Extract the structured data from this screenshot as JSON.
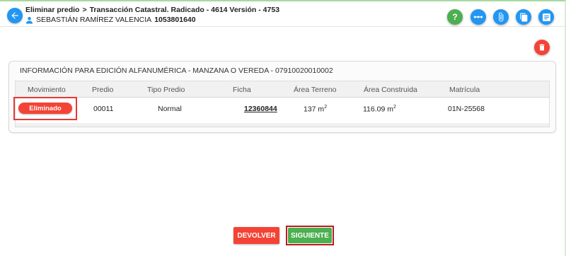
{
  "header": {
    "breadcrumb_1": "Eliminar predio",
    "breadcrumb_sep": ">",
    "breadcrumb_2": "Transacción Catastral. Radicado - 4614 Versión - 4753",
    "user_name": "SEBASTIÁN RAMÍREZ VALENCIA",
    "user_doc": "1053801640",
    "icons": [
      "arrow-left-icon",
      "help-icon",
      "dots-icon",
      "paperclip-icon",
      "copy-icon",
      "list-icon"
    ],
    "help_label": "?"
  },
  "accent_colors": {
    "blue": "#2196f3",
    "green": "#4caf50",
    "red": "#f44336"
  },
  "card": {
    "title": "INFORMACIÓN PARA EDICIÓN ALFANUMÉRICA - MANZANA O VEREDA - 07910020010002"
  },
  "table": {
    "headers": {
      "movimiento": "Movimiento",
      "predio": "Predio",
      "tipo_predio": "Tipo Predio",
      "ficha": "Ficha",
      "area_terreno": "Área Terreno",
      "area_construida": "Área Construida",
      "matricula": "Matrícula"
    },
    "rows": [
      {
        "movimiento": "Eliminado",
        "predio": "00011",
        "tipo_predio": "Normal",
        "ficha": "12360844",
        "area_terreno": "137 m",
        "area_terreno_sup": "2",
        "area_construida": "116.09 m",
        "area_construida_sup": "2",
        "matricula": "01N-25568"
      }
    ]
  },
  "actions": {
    "return_label": "DEVOLVER",
    "next_label": "SIGUIENTE"
  }
}
